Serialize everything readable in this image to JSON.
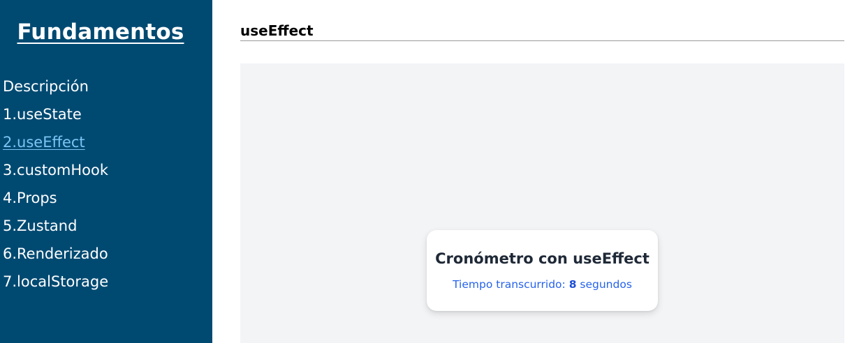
{
  "sidebar": {
    "brand": "Fundamentos",
    "items": [
      {
        "label": "Descripción",
        "active": false
      },
      {
        "label": "1.useState",
        "active": false
      },
      {
        "label": "2.useEffect",
        "active": true
      },
      {
        "label": "3.customHook",
        "active": false
      },
      {
        "label": "4.Props",
        "active": false
      },
      {
        "label": "5.Zustand",
        "active": false
      },
      {
        "label": "6.Renderizado",
        "active": false
      },
      {
        "label": "7.localStorage",
        "active": false
      }
    ]
  },
  "main": {
    "title": "useEffect",
    "card": {
      "title": "Cronómetro con useEffect",
      "text_prefix": "Tiempo transcurrido: ",
      "seconds": "8",
      "text_suffix": " segundos"
    }
  },
  "colors": {
    "sidebar_bg": "#004a72",
    "active_link": "#7cc4f4",
    "demo_bg": "#f3f4f6",
    "card_text": "#2563eb"
  }
}
